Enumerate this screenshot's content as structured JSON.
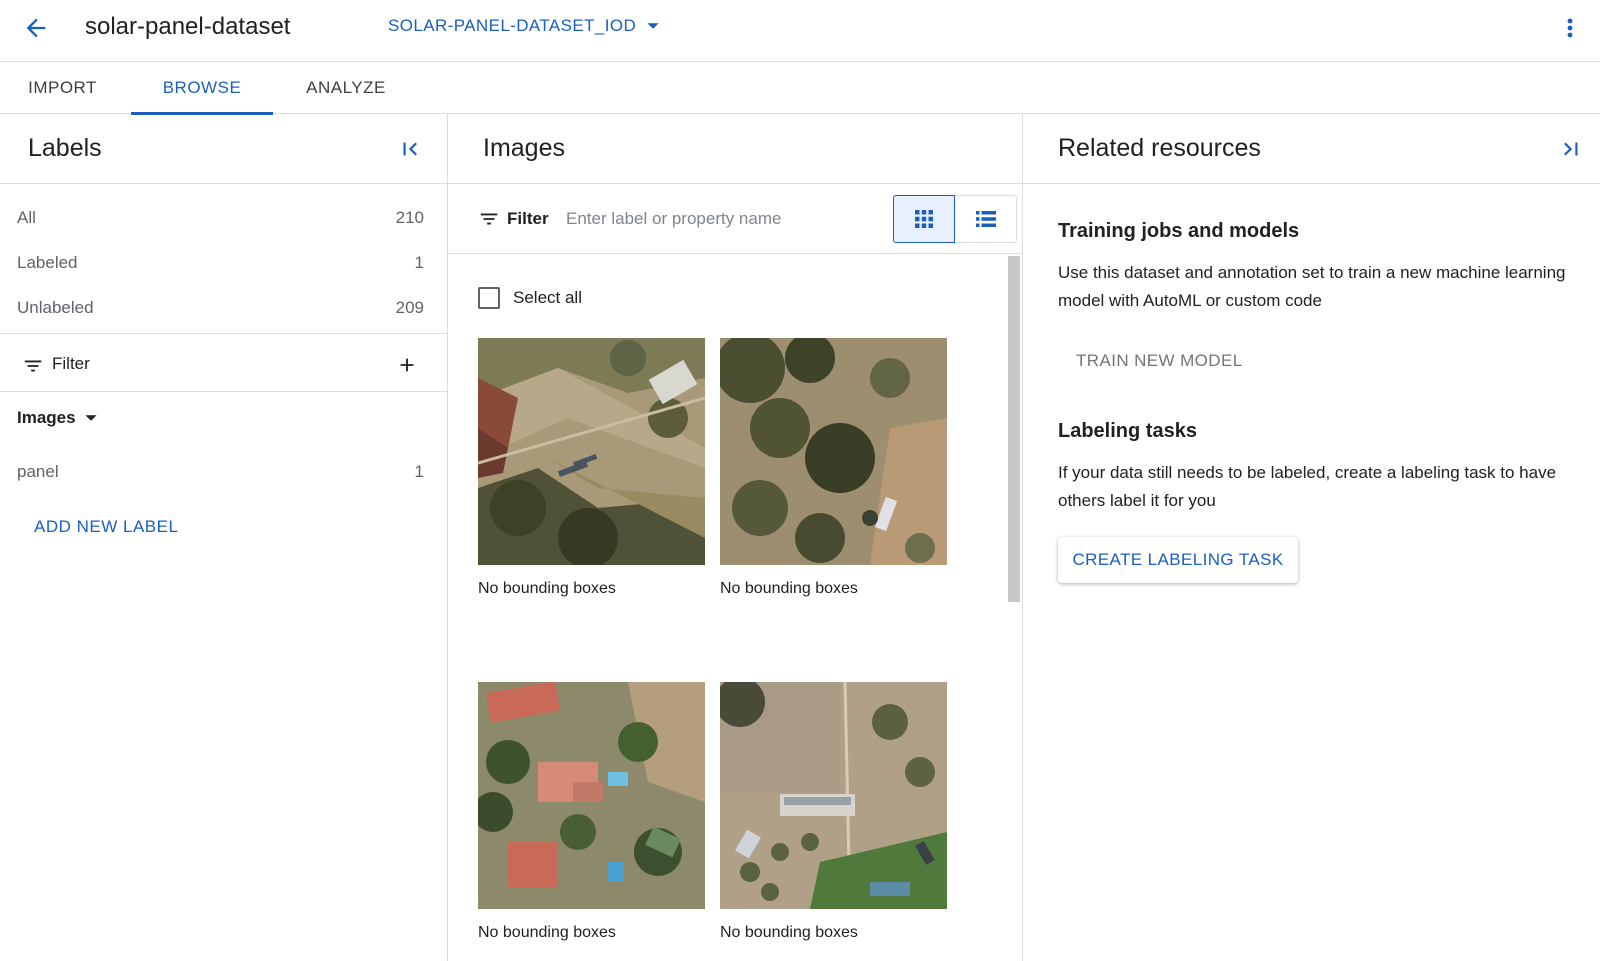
{
  "header": {
    "title": "solar-panel-dataset",
    "annotation_set": "SOLAR-PANEL-DATASET_IOD"
  },
  "tabs": [
    {
      "label": "IMPORT",
      "active": false
    },
    {
      "label": "BROWSE",
      "active": true
    },
    {
      "label": "ANALYZE",
      "active": false
    }
  ],
  "labels_panel": {
    "title": "Labels",
    "rows": [
      {
        "name": "All",
        "count": "210"
      },
      {
        "name": "Labeled",
        "count": "1"
      },
      {
        "name": "Unlabeled",
        "count": "209"
      }
    ],
    "filter_label": "Filter",
    "images_group": "Images",
    "label_items": [
      {
        "name": "panel",
        "count": "1"
      }
    ],
    "add_label": "ADD NEW LABEL"
  },
  "images_panel": {
    "title": "Images",
    "filter_label": "Filter",
    "filter_placeholder": "Enter label or property name",
    "select_all": "Select all",
    "items": [
      {
        "caption": "No bounding boxes"
      },
      {
        "caption": "No bounding boxes"
      },
      {
        "caption": "No bounding boxes"
      },
      {
        "caption": "No bounding boxes"
      }
    ]
  },
  "related_panel": {
    "title": "Related resources",
    "training": {
      "title": "Training jobs and models",
      "description": "Use this dataset and annotation set to train a new machine learning model with AutoML or custom code",
      "button": "TRAIN NEW MODEL"
    },
    "labeling": {
      "title": "Labeling tasks",
      "description": "If your data still needs to be labeled, create a labeling task to have others label it for you",
      "button": "CREATE LABELING TASK"
    }
  },
  "colors": {
    "accent": "#1a5fc0",
    "divider": "#dadce0",
    "muted_text": "#5f6368"
  }
}
